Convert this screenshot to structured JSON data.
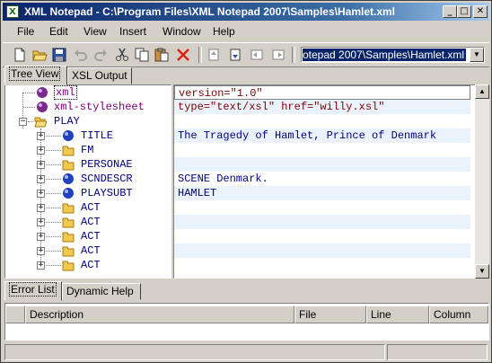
{
  "window": {
    "title": "XML Notepad - C:\\Program Files\\XML Notepad 2007\\Samples\\Hamlet.xml",
    "controls": {
      "minimize": "_",
      "maximize": "□",
      "close": "✕"
    }
  },
  "menu": [
    "File",
    "Edit",
    "View",
    "Insert",
    "Window",
    "Help"
  ],
  "toolbar": {
    "buttons": [
      "new-file",
      "open-file",
      "save",
      "undo",
      "redo",
      "cut",
      "copy",
      "paste",
      "delete",
      "nudge-up",
      "nudge-down",
      "nudge-left",
      "nudge-right"
    ],
    "path_value": "otepad 2007\\Samples\\Hamlet.xml"
  },
  "tabs": [
    "Tree View",
    "XSL Output"
  ],
  "tree": [
    {
      "label": "xml",
      "icon": "pi-icon",
      "level": 1,
      "expander": ""
    },
    {
      "label": "xml-stylesheet",
      "icon": "pi-icon",
      "level": 1,
      "expander": ""
    },
    {
      "label": "PLAY",
      "icon": "folder-open-icon",
      "level": 0,
      "expander": "−"
    },
    {
      "label": "TITLE",
      "icon": "leaf-icon",
      "level": 2,
      "expander": "+"
    },
    {
      "label": "FM",
      "icon": "folder-icon",
      "level": 2,
      "expander": "+"
    },
    {
      "label": "PERSONAE",
      "icon": "folder-icon",
      "level": 2,
      "expander": "+"
    },
    {
      "label": "SCNDESCR",
      "icon": "leaf-icon",
      "level": 2,
      "expander": "+"
    },
    {
      "label": "PLAYSUBT",
      "icon": "leaf-icon",
      "level": 2,
      "expander": "+"
    },
    {
      "label": "ACT",
      "icon": "folder-icon",
      "level": 2,
      "expander": "+"
    },
    {
      "label": "ACT",
      "icon": "folder-icon",
      "level": 2,
      "expander": "+"
    },
    {
      "label": "ACT",
      "icon": "folder-icon",
      "level": 2,
      "expander": "+"
    },
    {
      "label": "ACT",
      "icon": "folder-icon",
      "level": 2,
      "expander": "+"
    },
    {
      "label": "ACT",
      "icon": "folder-icon",
      "level": 2,
      "expander": "+"
    }
  ],
  "values": [
    "version=\"1.0\"",
    "type=\"text/xsl\" href=\"willy.xsl\"",
    "",
    "The Tragedy of Hamlet, Prince of Denmark",
    "",
    "",
    "SCENE  Denmark.",
    "HAMLET",
    "",
    "",
    "",
    "",
    ""
  ],
  "bottom_tabs": [
    "Error List",
    "Dynamic Help"
  ],
  "error_columns": [
    "",
    "Description",
    "File",
    "Line",
    "Column"
  ],
  "colors": {
    "pi_text": "#800080",
    "value_text": "#800000",
    "element_text": "#000080",
    "title_start": "#0a246a",
    "title_end": "#a6caf0"
  }
}
